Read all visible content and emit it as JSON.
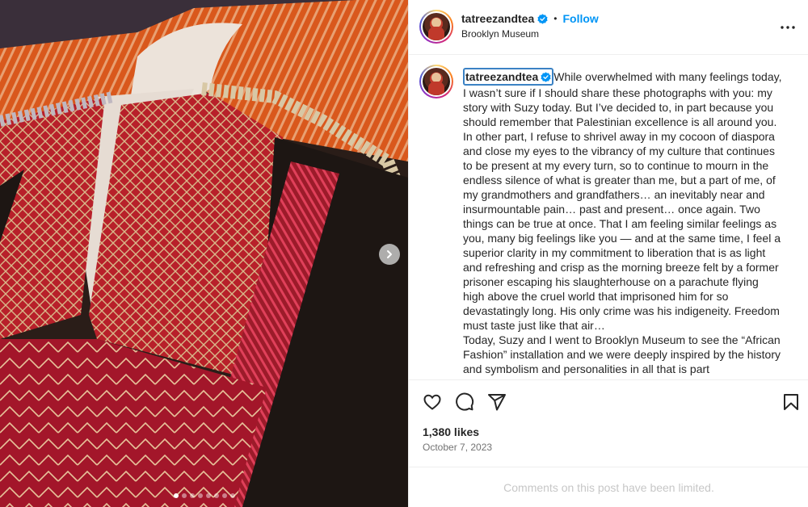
{
  "post": {
    "username": "tatreezandtea",
    "follow_label": "Follow",
    "separator": "•",
    "location": "Brooklyn Museum",
    "caption_paragraphs": [
      "While overwhelmed with many feelings today, I wasn’t sure if I should share these photographs with you: my story with Suzy today. But I’ve decided to, in part because you should remember that Palestinian excellence is all around you. In other part, I refuse to shrivel away in my cocoon of diaspora and close my eyes to the vibrancy of my culture that continues to be present at my every turn, so to continue to mourn in the endless silence of what is greater than me, but a part of me, of my grandmothers and grandfathers… an inevitably near and insurmountable pain… past and present… once again. Two things can be true at once. That I am feeling similar feelings as you, many big feelings like you — and at the same time, I feel a superior clarity in my commitment to liberation that is as light and refreshing and crisp as the morning breeze felt by a former prisoner escaping his slaughterhouse on a parachute flying high above the cruel world that imprisoned him for so devastatingly long. His only crime was his indigeneity. Freedom must taste just like that air…",
      "Today, Suzy and I went to Brooklyn Museum to see the “African Fashion” installation and we were deeply inspired by the history and symbolism and personalities in all that is part"
    ],
    "likes": "1,380 likes",
    "date": "October 7, 2023",
    "comments_notice": "Comments on this post have been limited."
  },
  "carousel": {
    "count": 8,
    "active_index": 0
  },
  "icons": {
    "verified": "verified-badge-icon",
    "more": "more-options-icon",
    "like": "heart-icon",
    "comment": "comment-icon",
    "share": "paper-plane-icon",
    "save": "bookmark-icon",
    "next": "chevron-right-icon"
  },
  "colors": {
    "accent": "#0095f6",
    "verified": "#0095f6",
    "muted": "#737373"
  }
}
